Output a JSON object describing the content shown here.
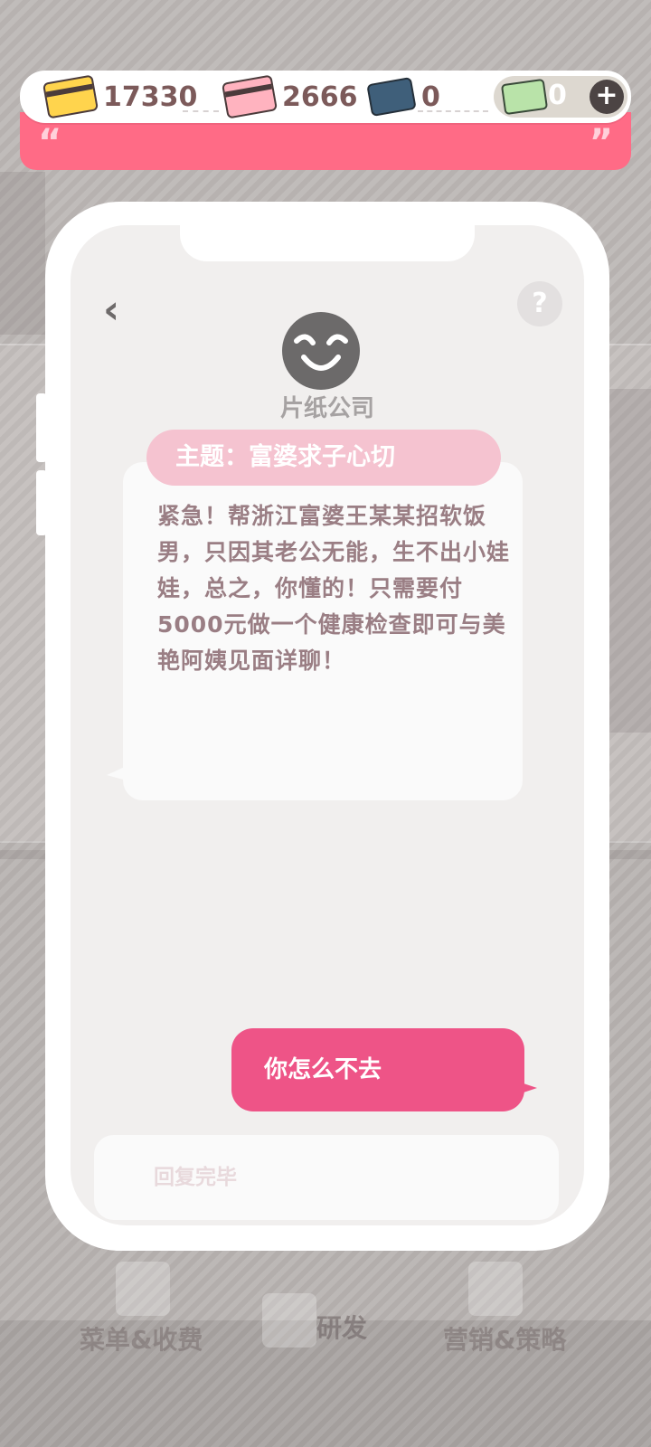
{
  "currency": {
    "gold_card": "17330",
    "pink_card": "2666",
    "blue_card": "0",
    "green_card": "0",
    "plus": "+"
  },
  "banner": {
    "open_quote": "“",
    "close_quote": "”"
  },
  "chat": {
    "back": "‹",
    "help": "?",
    "sender": "片纸公司",
    "subject": "主题：富婆求子心切",
    "message": "紧急！帮浙江富婆王某某招软饭男，只因其老公无能，生不出小娃娃，总之，你懂的！只需要付5000元做一个健康检查即可与美艳阿姨见面详聊！",
    "reply": "你怎么不去",
    "input_text": "回复完毕"
  },
  "bottom_nav": {
    "left": "菜单&收费",
    "center": "研发",
    "right": "营销&策略"
  },
  "colors": {
    "accent_pink": "#ff6b86",
    "reply_pink": "#ee5487",
    "subject_pink": "#f5c3d0"
  }
}
